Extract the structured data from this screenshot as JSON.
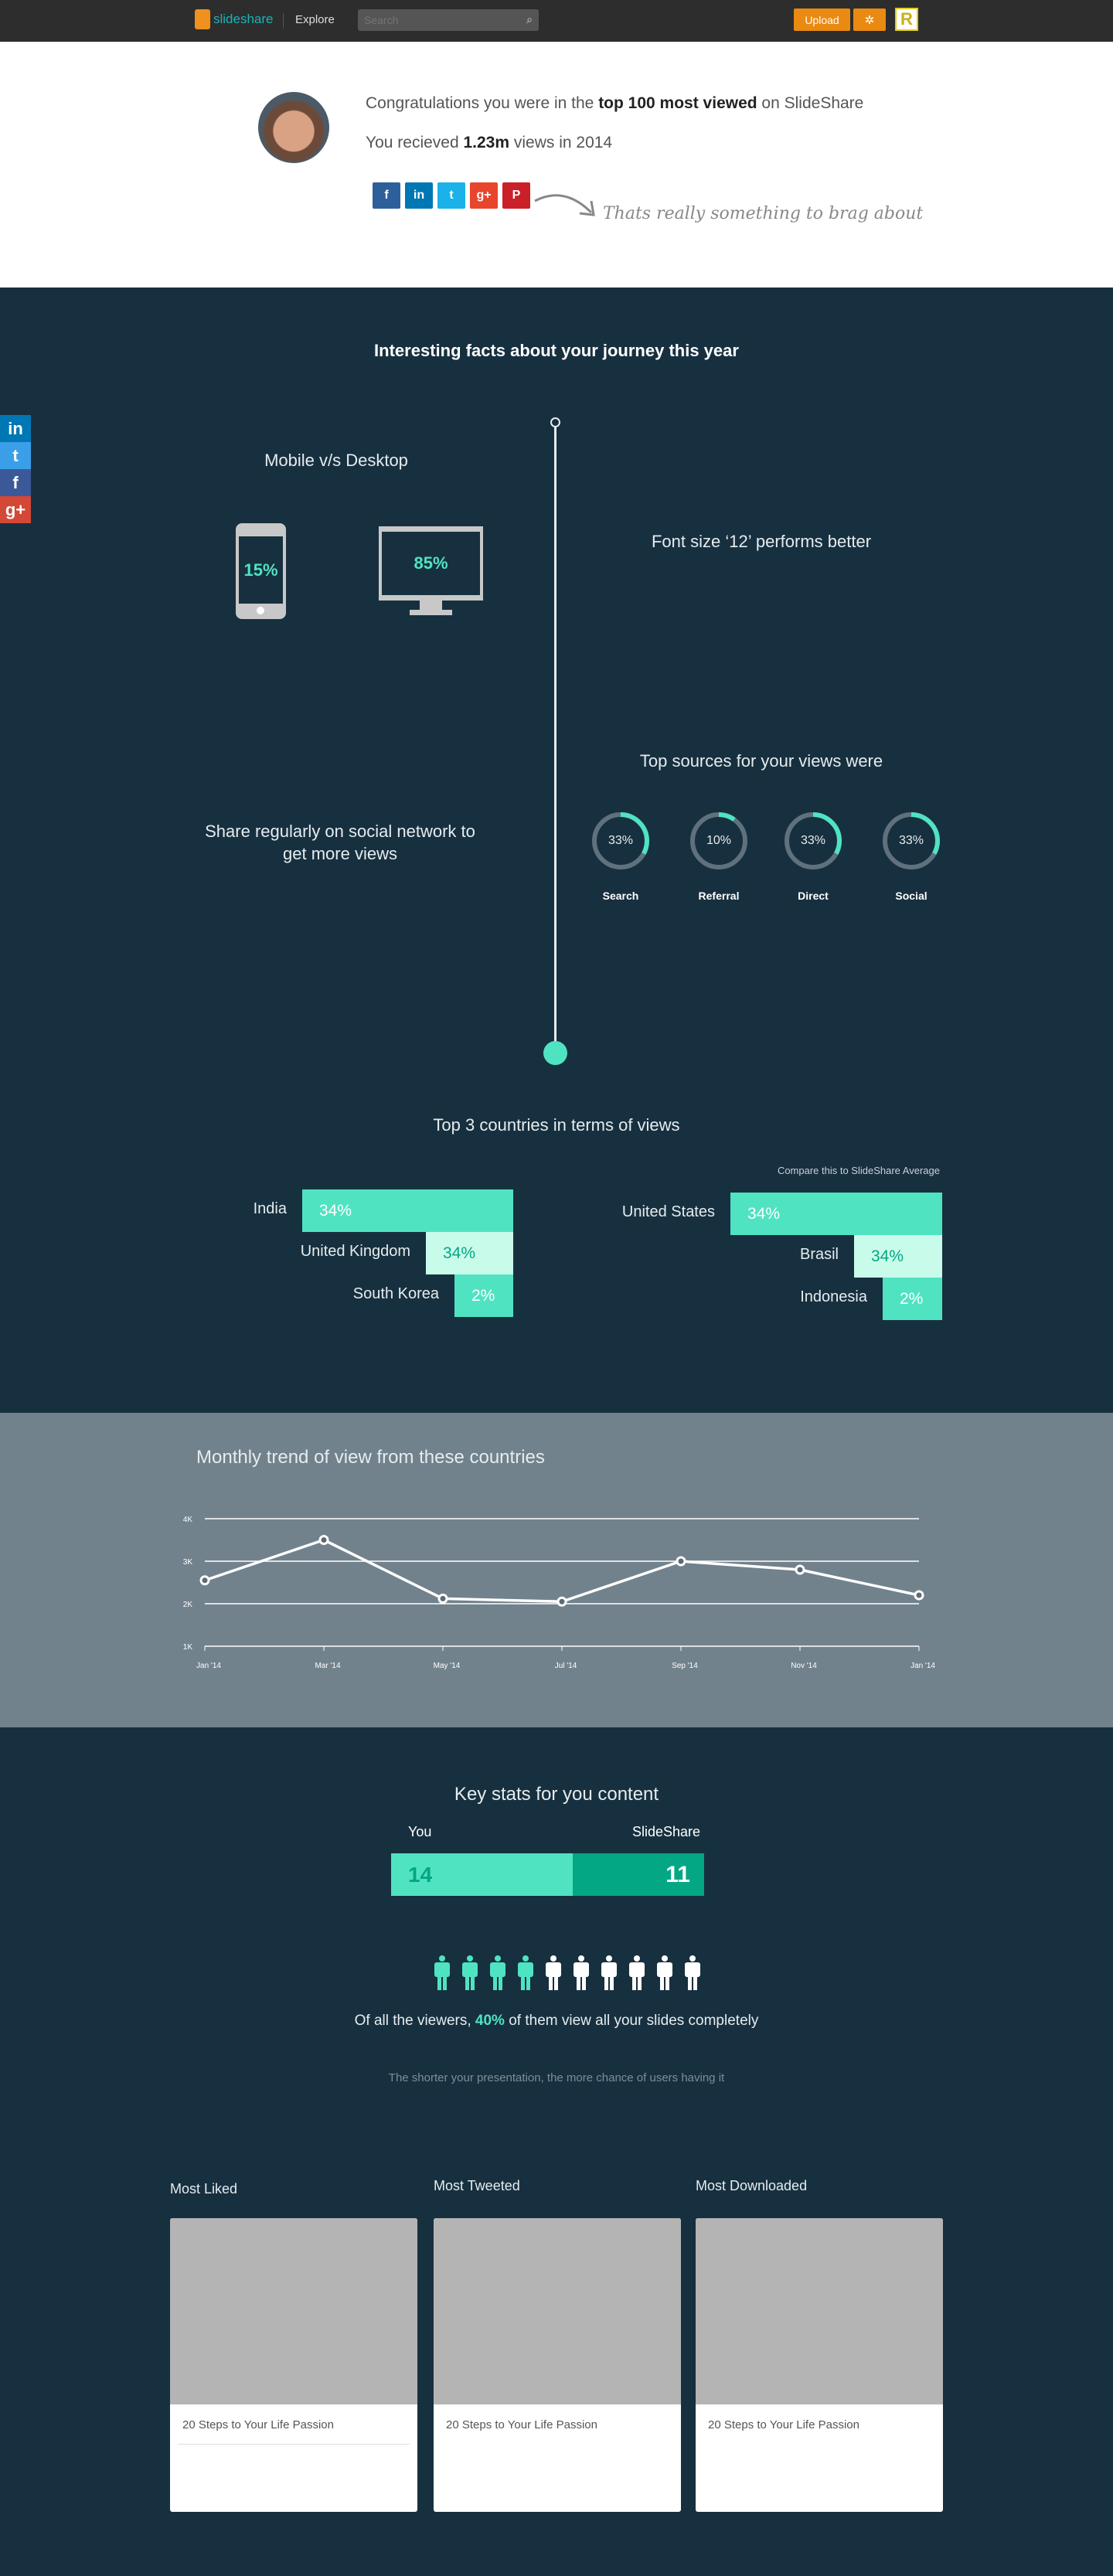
{
  "nav": {
    "logo": "slideshare",
    "explore": "Explore",
    "search_placeholder": "Search",
    "upload": "Upload"
  },
  "hero": {
    "line1_pre": "Congratulations you were in the ",
    "line1_bold": "top 100 most viewed",
    "line1_post": " on SlideShare",
    "line2_pre": "You recieved ",
    "line2_bold": "1.23m",
    "line2_post": " views in 2014",
    "brag": "Thats really something to brag about",
    "share_buttons": [
      {
        "icon": "facebook-icon",
        "glyph": "f",
        "color": "#2d5f9a"
      },
      {
        "icon": "linkedin-icon",
        "glyph": "in",
        "color": "#0077b5"
      },
      {
        "icon": "twitter-icon",
        "glyph": "t",
        "color": "#1ab2e8"
      },
      {
        "icon": "google-plus-icon",
        "glyph": "g+",
        "color": "#e8452c"
      },
      {
        "icon": "pinterest-icon",
        "glyph": "P",
        "color": "#cb2027"
      }
    ]
  },
  "side_share": [
    {
      "icon": "linkedin-icon",
      "glyph": "in",
      "color": "#0077b5"
    },
    {
      "icon": "twitter-icon",
      "glyph": "t",
      "color": "#3a9fe8"
    },
    {
      "icon": "facebook-icon",
      "glyph": "f",
      "color": "#3b5998"
    },
    {
      "icon": "google-plus-icon",
      "glyph": "g+",
      "color": "#d34836"
    }
  ],
  "facts": {
    "title": "Interesting facts about your journey this year",
    "mobile_desktop": "Mobile v/s Desktop",
    "mobile_pct": "15%",
    "desktop_pct": "85%",
    "font_size": "Font size ‘12’ performs better",
    "share_line1": "Share regularly on social network to",
    "share_line2": "get more views",
    "sources_title": "Top sources for your views were",
    "sources": [
      {
        "label": "Search",
        "value": "33%",
        "fraction": 0.33
      },
      {
        "label": "Referral",
        "value": "10%",
        "fraction": 0.1
      },
      {
        "label": "Direct",
        "value": "33%",
        "fraction": 0.33
      },
      {
        "label": "Social",
        "value": "33%",
        "fraction": 0.33
      }
    ]
  },
  "countries": {
    "title": "Top 3 countries in terms of views",
    "compare": "Compare this to SlideShare Average",
    "yours": [
      {
        "name": "India",
        "value": "34%"
      },
      {
        "name": "United Kingdom",
        "value": "34%"
      },
      {
        "name": "South Korea",
        "value": "2%"
      }
    ],
    "average": [
      {
        "name": "United States",
        "value": "34%"
      },
      {
        "name": "Brasil",
        "value": "34%"
      },
      {
        "name": "Indonesia",
        "value": "2%"
      }
    ]
  },
  "chart_data": {
    "type": "line",
    "title": "Monthly trend of view from these countries",
    "categories": [
      "Jan '14",
      "Mar '14",
      "May '14",
      "Jul '14",
      "Sep '14",
      "Nov '14",
      "Jan '14"
    ],
    "values": [
      2550,
      3500,
      2120,
      2050,
      3000,
      2800,
      2200
    ],
    "yticks": [
      "1K",
      "2K",
      "3K",
      "4K"
    ],
    "ylim": [
      1000,
      4000
    ],
    "grid": true
  },
  "key_stats": {
    "title": "Key stats for you content",
    "you_label": "You",
    "ss_label": "SlideShare",
    "you_value": "14",
    "ss_value": "11",
    "viewers_pre": "Of all the viewers, ",
    "viewers_bold": "40%",
    "viewers_post": " of them view all your slides completely",
    "viewers_fraction": 0.4,
    "hint": "The shorter your presentation, the more chance of users having it"
  },
  "top_content": [
    {
      "heading": "Most Liked",
      "title": "20 Steps to Your Life Passion"
    },
    {
      "heading": "Most Tweeted",
      "title": "20 Steps to Your Life Passion"
    },
    {
      "heading": "Most Downloaded",
      "title": "20 Steps to Your Life Passion"
    }
  ]
}
